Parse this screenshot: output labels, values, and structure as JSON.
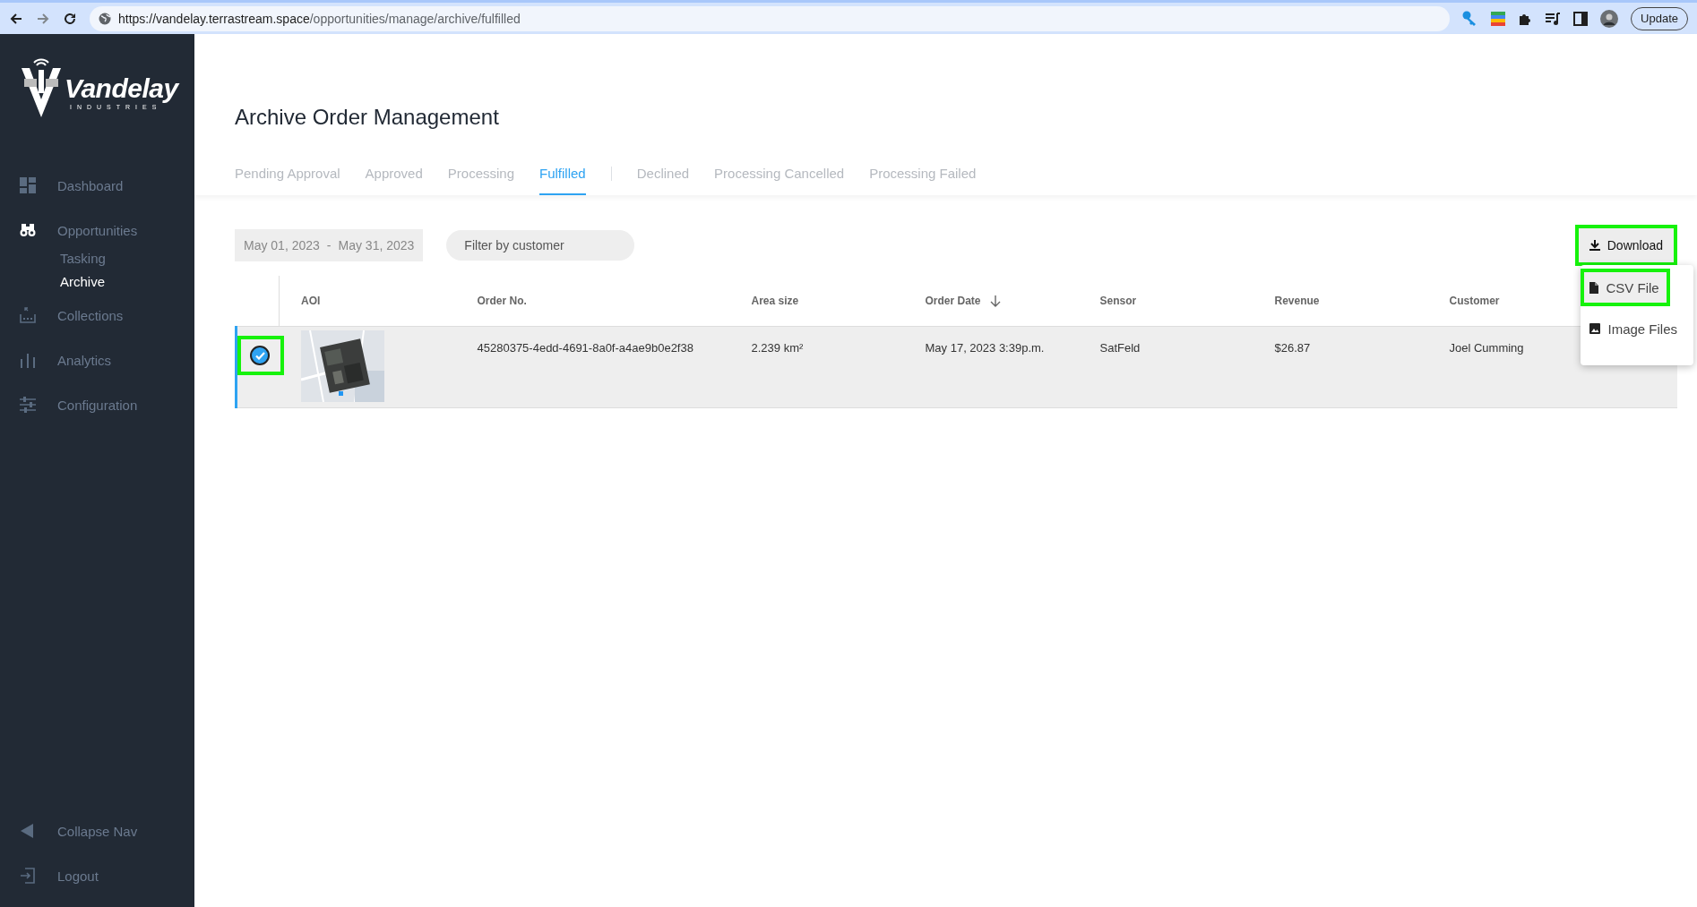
{
  "browser": {
    "url_host": "https://vandelay.terrastream.space",
    "url_path": "/opportunities/manage/archive/fulfilled",
    "update_button": "Update"
  },
  "sidebar": {
    "logo": {
      "name": "Vandelay",
      "tagline": "INDUSTRIES"
    },
    "items": [
      {
        "label": "Dashboard",
        "selected": false
      },
      {
        "label": "Opportunities",
        "selected": false,
        "expanded": true,
        "children": [
          {
            "label": "Tasking",
            "selected": false
          },
          {
            "label": "Archive",
            "selected": true
          }
        ]
      },
      {
        "label": "Collections",
        "selected": false
      },
      {
        "label": "Analytics",
        "selected": false
      },
      {
        "label": "Configuration",
        "selected": false
      }
    ],
    "footer": [
      {
        "label": "Collapse Nav"
      },
      {
        "label": "Logout"
      }
    ]
  },
  "page": {
    "title": "Archive Order Management",
    "tab_groups": [
      [
        {
          "label": "Pending Approval",
          "selected": false
        },
        {
          "label": "Approved",
          "selected": false
        },
        {
          "label": "Processing",
          "selected": false
        },
        {
          "label": "Fulfilled",
          "selected": true
        }
      ],
      [
        {
          "label": "Declined",
          "selected": false
        },
        {
          "label": "Processing Cancelled",
          "selected": false
        },
        {
          "label": "Processing Failed",
          "selected": false
        }
      ]
    ],
    "date_range": {
      "start": "May 01, 2023",
      "separator": "-",
      "end": "May 31, 2023"
    },
    "customer_filter": {
      "placeholder": "Filter by customer"
    },
    "download": {
      "label": "Download",
      "highlighted": true,
      "menu": [
        {
          "label": "CSV File",
          "selected": true,
          "highlighted": true
        },
        {
          "label": "Image Files",
          "selected": false,
          "highlighted": false
        }
      ]
    },
    "table": {
      "columns": [
        {
          "label": "AOI",
          "sorted": false
        },
        {
          "label": "Order No.",
          "sorted": false
        },
        {
          "label": "Area size",
          "sorted": false
        },
        {
          "label": "Order Date",
          "sorted": true
        },
        {
          "label": "Sensor",
          "sorted": false
        },
        {
          "label": "Revenue",
          "sorted": false
        },
        {
          "label": "Customer",
          "sorted": false
        }
      ],
      "rows": [
        {
          "selected": true,
          "highlighted": true,
          "cells": [
            {
              "kind": "picture"
            },
            "45280375-4edd-4691-8a0f-a4ae9b0e2f38",
            "2.239 km²",
            "May 17, 2023 3:39p.m.",
            "SatFeld",
            "$26.87",
            "Joel Cumming"
          ]
        }
      ]
    }
  }
}
